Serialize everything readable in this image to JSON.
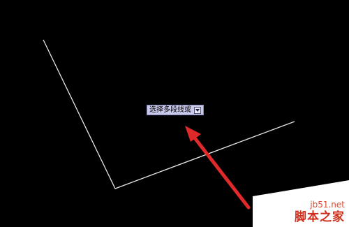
{
  "canvas": {
    "background": "#000000",
    "polyline_color": "#e6e6e6",
    "arrow_color": "#e02a2a"
  },
  "command_prompt": {
    "text": "选择多段线或",
    "options_icon": "dropdown-arrow-icon"
  },
  "watermark": {
    "url": "jb51.net",
    "name": "脚本之家",
    "color": "#cf2e1a"
  }
}
